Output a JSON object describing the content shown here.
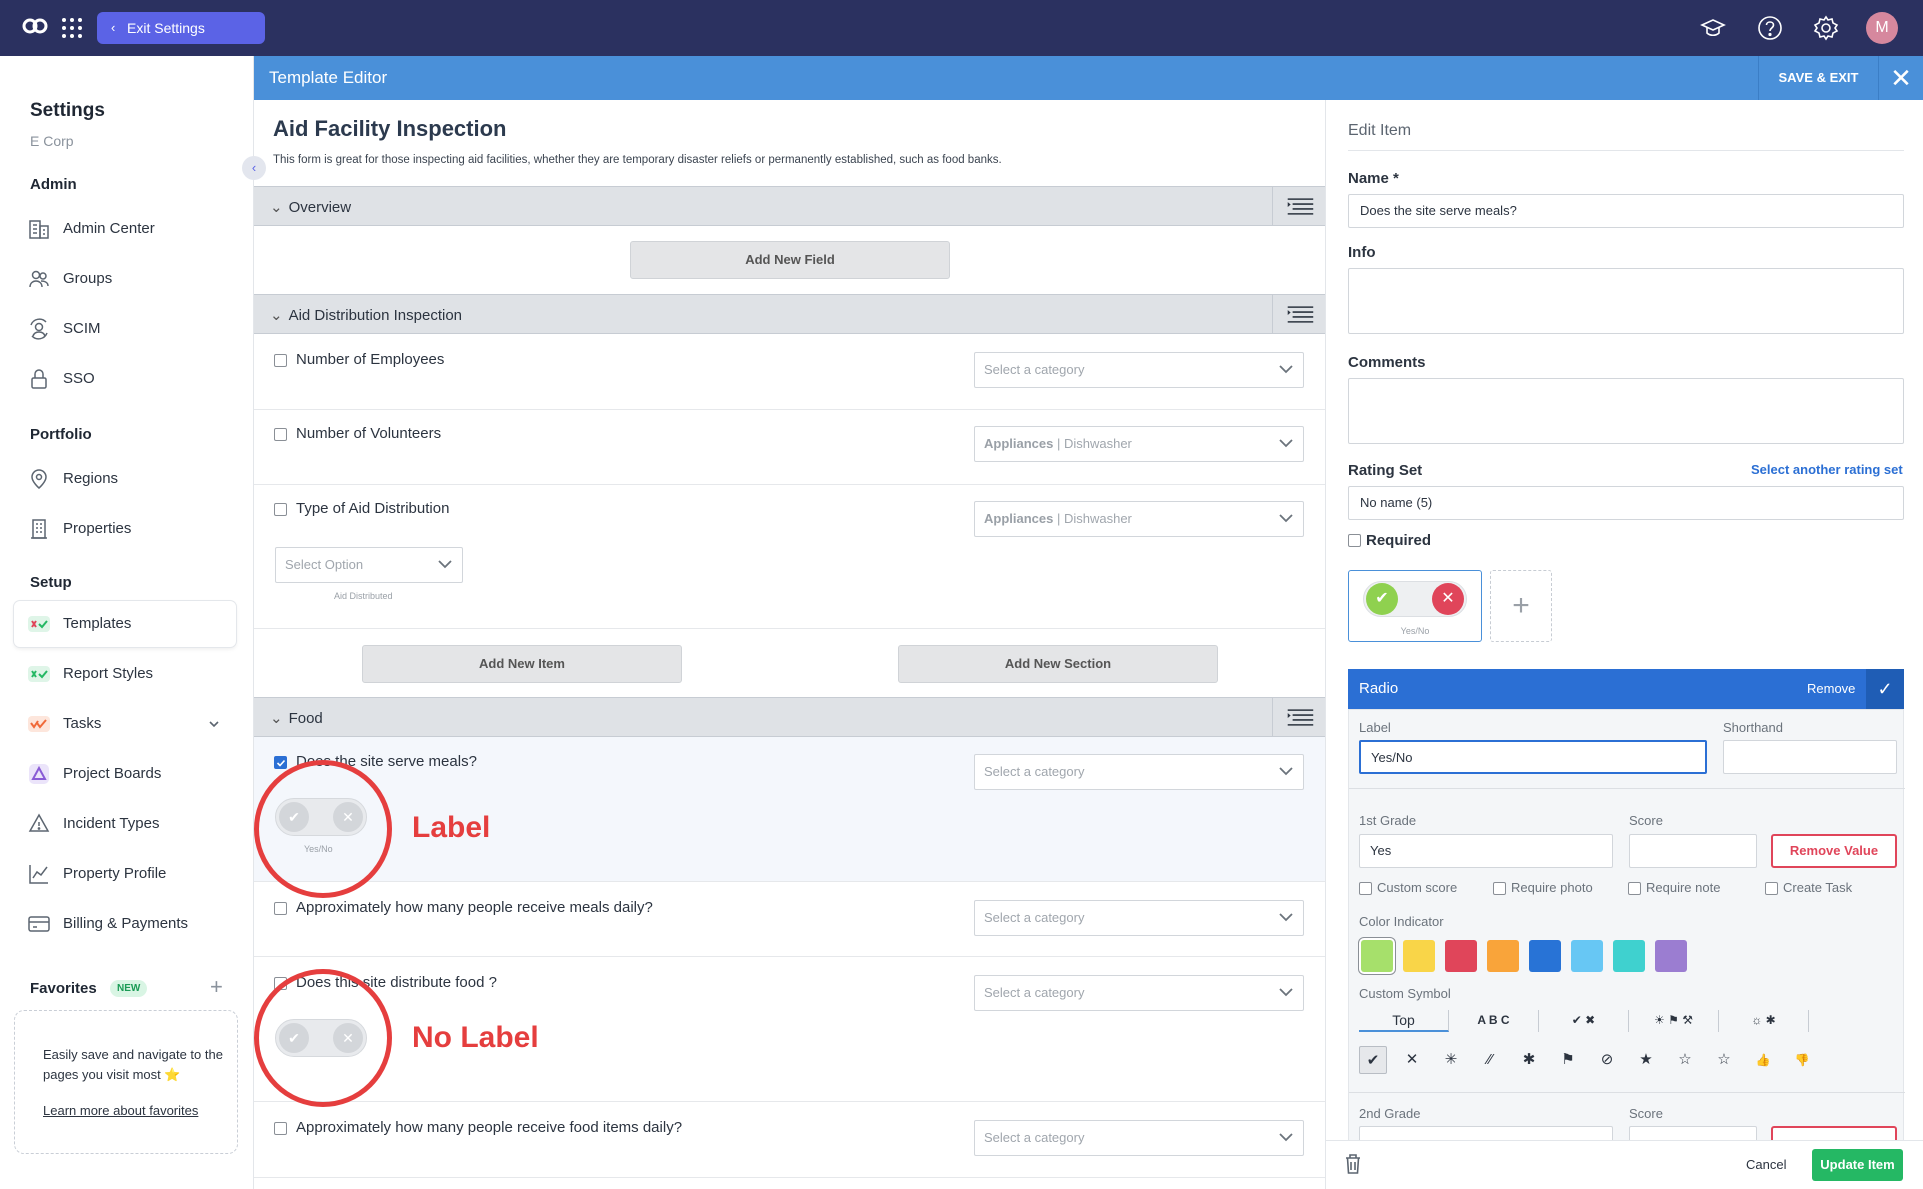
{
  "topbar": {
    "exit_label": "Exit Settings",
    "avatar_letter": "M",
    "accent": "#5b63e6",
    "bg": "#2b3160"
  },
  "sidebar": {
    "title": "Settings",
    "org": "E Corp",
    "sections": [
      "Admin",
      "Portfolio",
      "Setup"
    ],
    "items": [
      {
        "label": "Admin Center",
        "icon": "building-icon"
      },
      {
        "label": "Groups",
        "icon": "users-icon"
      },
      {
        "label": "SCIM",
        "icon": "user-sync-icon"
      },
      {
        "label": "SSO",
        "icon": "lock-icon"
      },
      {
        "label": "Regions",
        "icon": "map-pin-icon"
      },
      {
        "label": "Properties",
        "icon": "building-icon"
      },
      {
        "label": "Templates",
        "icon": "templates-icon"
      },
      {
        "label": "Report Styles",
        "icon": "report-styles-icon"
      },
      {
        "label": "Tasks",
        "icon": "tasks-icon"
      },
      {
        "label": "Project Boards",
        "icon": "project-boards-icon"
      },
      {
        "label": "Incident Types",
        "icon": "warning-icon"
      },
      {
        "label": "Property Profile",
        "icon": "chart-icon"
      },
      {
        "label": "Billing & Payments",
        "icon": "credit-card-icon"
      }
    ],
    "favorites": {
      "title": "Favorites",
      "badge": "NEW",
      "text": "Easily save and navigate to the pages you visit most ⭐",
      "link": "Learn more about favorites"
    }
  },
  "editor": {
    "bar_title": "Template Editor",
    "save_exit": "SAVE & EXIT",
    "form": {
      "title": "Aid Facility Inspection",
      "description": "This form is great for those inspecting aid facilities, whether they are temporary disaster reliefs or permanently established, such as food banks.",
      "sections": [
        {
          "name": "Overview"
        },
        {
          "name": "Aid Distribution Inspection"
        },
        {
          "name": "Food"
        }
      ],
      "add_new_field": "Add New Field",
      "add_new_item": "Add New Item",
      "add_new_section": "Add New Section",
      "questions": [
        {
          "text": "Number of Employees",
          "category": "Select a category",
          "checked": false
        },
        {
          "text": "Number of Volunteers",
          "category_bold": "Appliances",
          "category_rest": " | Dishwasher",
          "checked": false
        },
        {
          "text": "Type of Aid Distribution",
          "category_bold": "Appliances",
          "category_rest": " | Dishwasher",
          "checked": false
        },
        {
          "text": "Does the site serve meals?",
          "category": "Select a category",
          "checked": true
        },
        {
          "text": "Approximately how many people receive meals daily?",
          "category": "Select a category",
          "checked": false
        },
        {
          "text": "Does this site distribute food ?",
          "category": "Select a category",
          "checked": false
        },
        {
          "text": "Approximately how many people receive food items daily?",
          "category": "Select a category",
          "checked": false
        }
      ],
      "select_option": "Select Option",
      "aid_distributed": "Aid Distributed",
      "yes_no": "Yes/No",
      "annotation_label": "Label",
      "annotation_nolabel": "No Label"
    },
    "panel": {
      "heading": "Edit Item",
      "name_label": "Name *",
      "name_value": "Does the site serve meals?",
      "info_label": "Info",
      "comments_label": "Comments",
      "rating_set_label": "Rating Set",
      "rating_set_link": "Select another rating set",
      "rating_set_value": "No name (5)",
      "required_label": "Required",
      "preview_caption": "Yes/No",
      "radio": {
        "title": "Radio",
        "remove": "Remove",
        "label_label": "Label",
        "label_value": "Yes/No",
        "shorthand_label": "Shorthand",
        "grade1_label": "1st Grade",
        "grade1_value": "Yes",
        "score_label": "Score",
        "remove_value": "Remove Value",
        "checks": [
          "Custom score",
          "Require photo",
          "Require note",
          "Create Task"
        ],
        "color_indicator_label": "Color Indicator",
        "colors": [
          "#a6e06b",
          "#f9d548",
          "#e0455a",
          "#f9a43a",
          "#2873d6",
          "#67c7f4",
          "#3fd1cf",
          "#9b7dd1"
        ],
        "custom_symbol_label": "Custom Symbol",
        "tabs": [
          "Top",
          "A B C",
          "✔ ✖",
          "☀ ⚑ ⚒",
          "☼ ✱"
        ],
        "symbols": [
          "✔",
          "✕",
          "✳",
          "⁄⁄",
          "✱",
          "⚑",
          "⊘",
          "★",
          "☆",
          "☆",
          "👍",
          "👎"
        ],
        "grade2_label": "2nd Grade",
        "score2_label": "Score"
      },
      "cancel": "Cancel",
      "update": "Update Item"
    }
  }
}
